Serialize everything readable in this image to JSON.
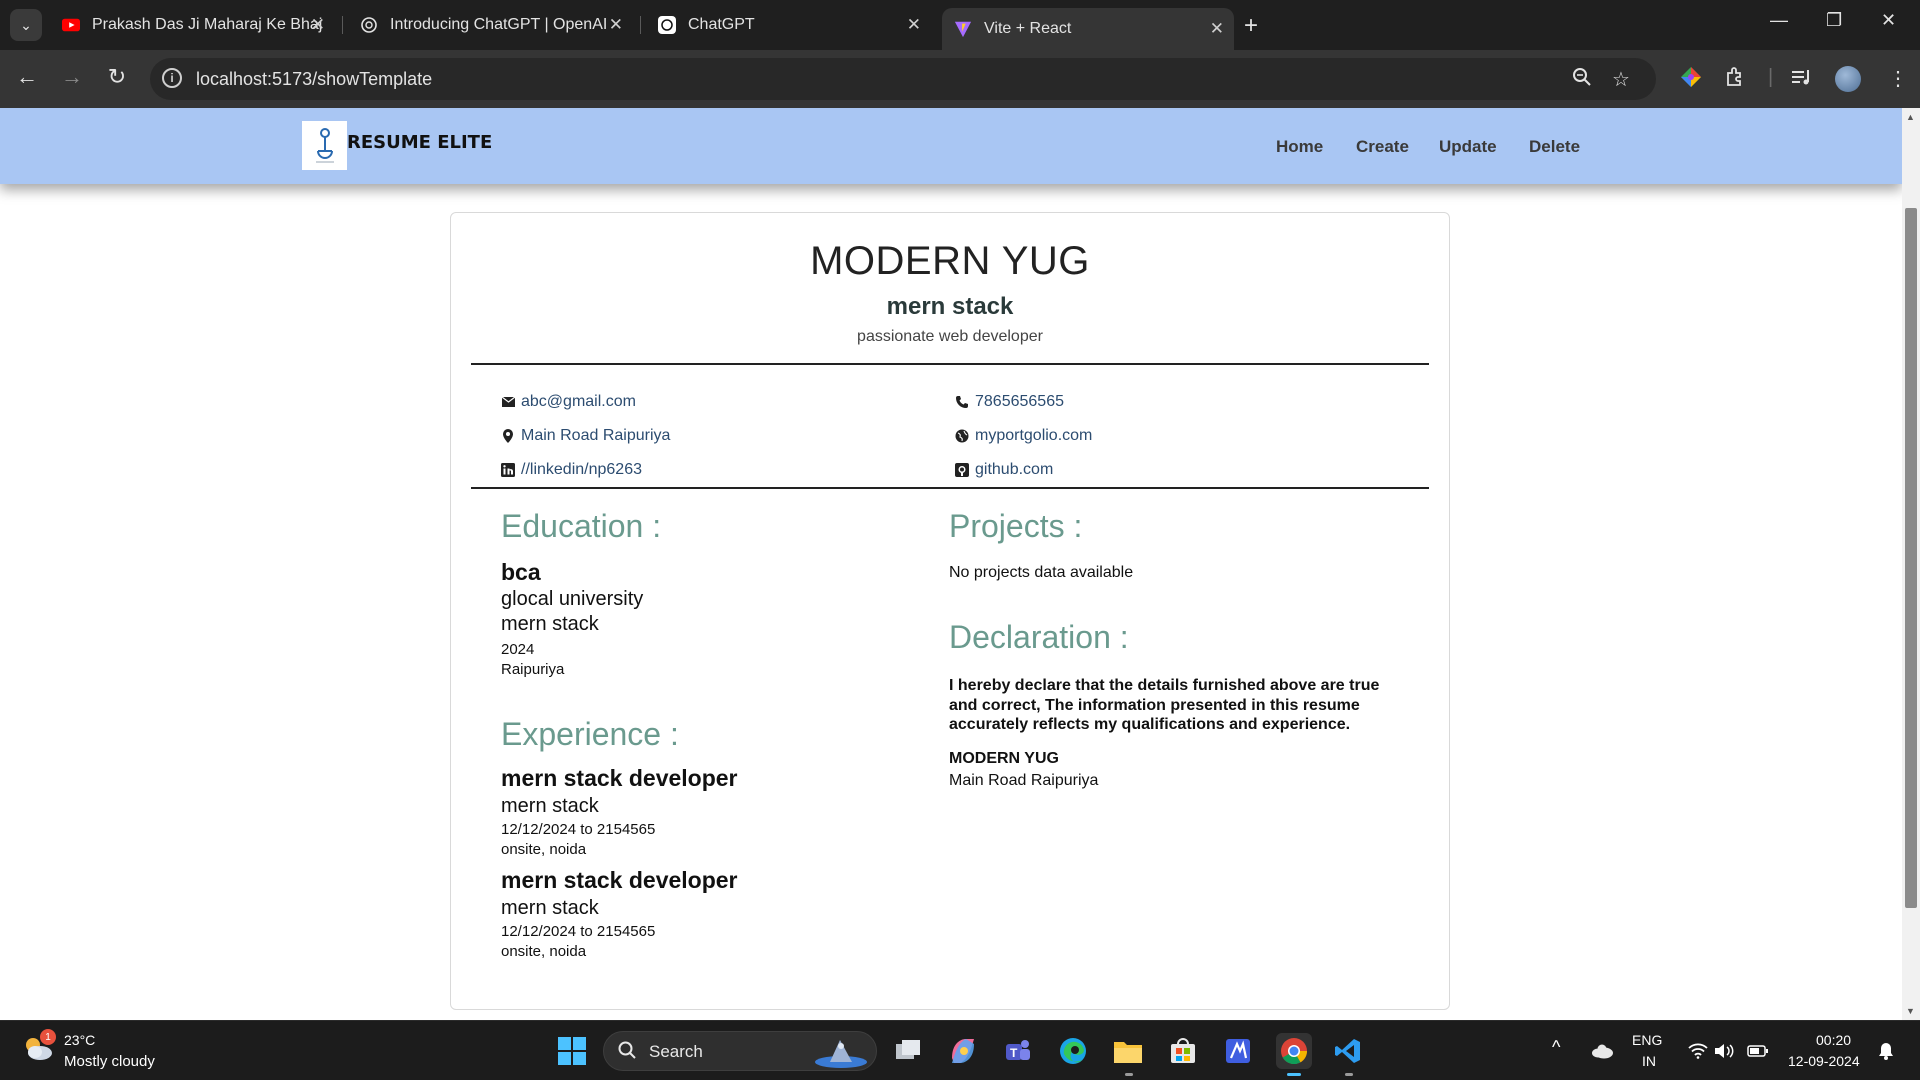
{
  "browser": {
    "tabs": [
      {
        "title": "Prakash Das Ji Maharaj Ke Bhajan",
        "favicon": "youtube-icon"
      },
      {
        "title": "Introducing ChatGPT | OpenAI",
        "favicon": "openai-icon"
      },
      {
        "title": "ChatGPT",
        "favicon": "chatgpt-icon"
      },
      {
        "title": "Vite + React",
        "favicon": "vite-icon"
      }
    ],
    "active_tab": 3,
    "url": "localhost:5173/showTemplate"
  },
  "app": {
    "brand": "RESUME ELITE",
    "nav": [
      "Home",
      "Create",
      "Update",
      "Delete"
    ],
    "nav_color": "#a9c6f3"
  },
  "resume": {
    "name": "MODERN YUG",
    "role": "mern stack",
    "summary": "passionate web developer",
    "contacts": {
      "email": "abc@gmail.com",
      "phone": "7865656565",
      "address": "Main Road Raipuriya",
      "portfolio": "myportgolio.com",
      "linkedin": "//linkedin/np6263",
      "github": "github.com"
    },
    "education_title": "Education :",
    "education": {
      "degree": "bca",
      "university": "glocal university",
      "field": "mern stack",
      "year": "2024",
      "location": "Raipuriya"
    },
    "experience_title": "Experience :",
    "experience": [
      {
        "title": "mern stack developer",
        "company": "mern stack",
        "dates": "12/12/2024 to 2154565",
        "location": "onsite, noida"
      },
      {
        "title": "mern stack developer",
        "company": "mern stack",
        "dates": "12/12/2024 to 2154565",
        "location": "onsite, noida"
      }
    ],
    "projects_title": "Projects :",
    "projects_empty": "No projects data available",
    "declaration_title": "Declaration :",
    "declaration_text": "I hereby declare that the details furnished above are true and correct, The information presented in this resume accurately reflects my qualifications and experience.",
    "signature_name": "MODERN YUG",
    "signature_place": "Main Road Raipuriya",
    "section_color": "#6a9a8e"
  },
  "taskbar": {
    "weather_temp": "23°C",
    "weather_desc": "Mostly cloudy",
    "weather_badge": "1",
    "search_label": "Search",
    "lang_line1": "ENG",
    "lang_line2": "IN",
    "time": "00:20",
    "date": "12-09-2024"
  }
}
